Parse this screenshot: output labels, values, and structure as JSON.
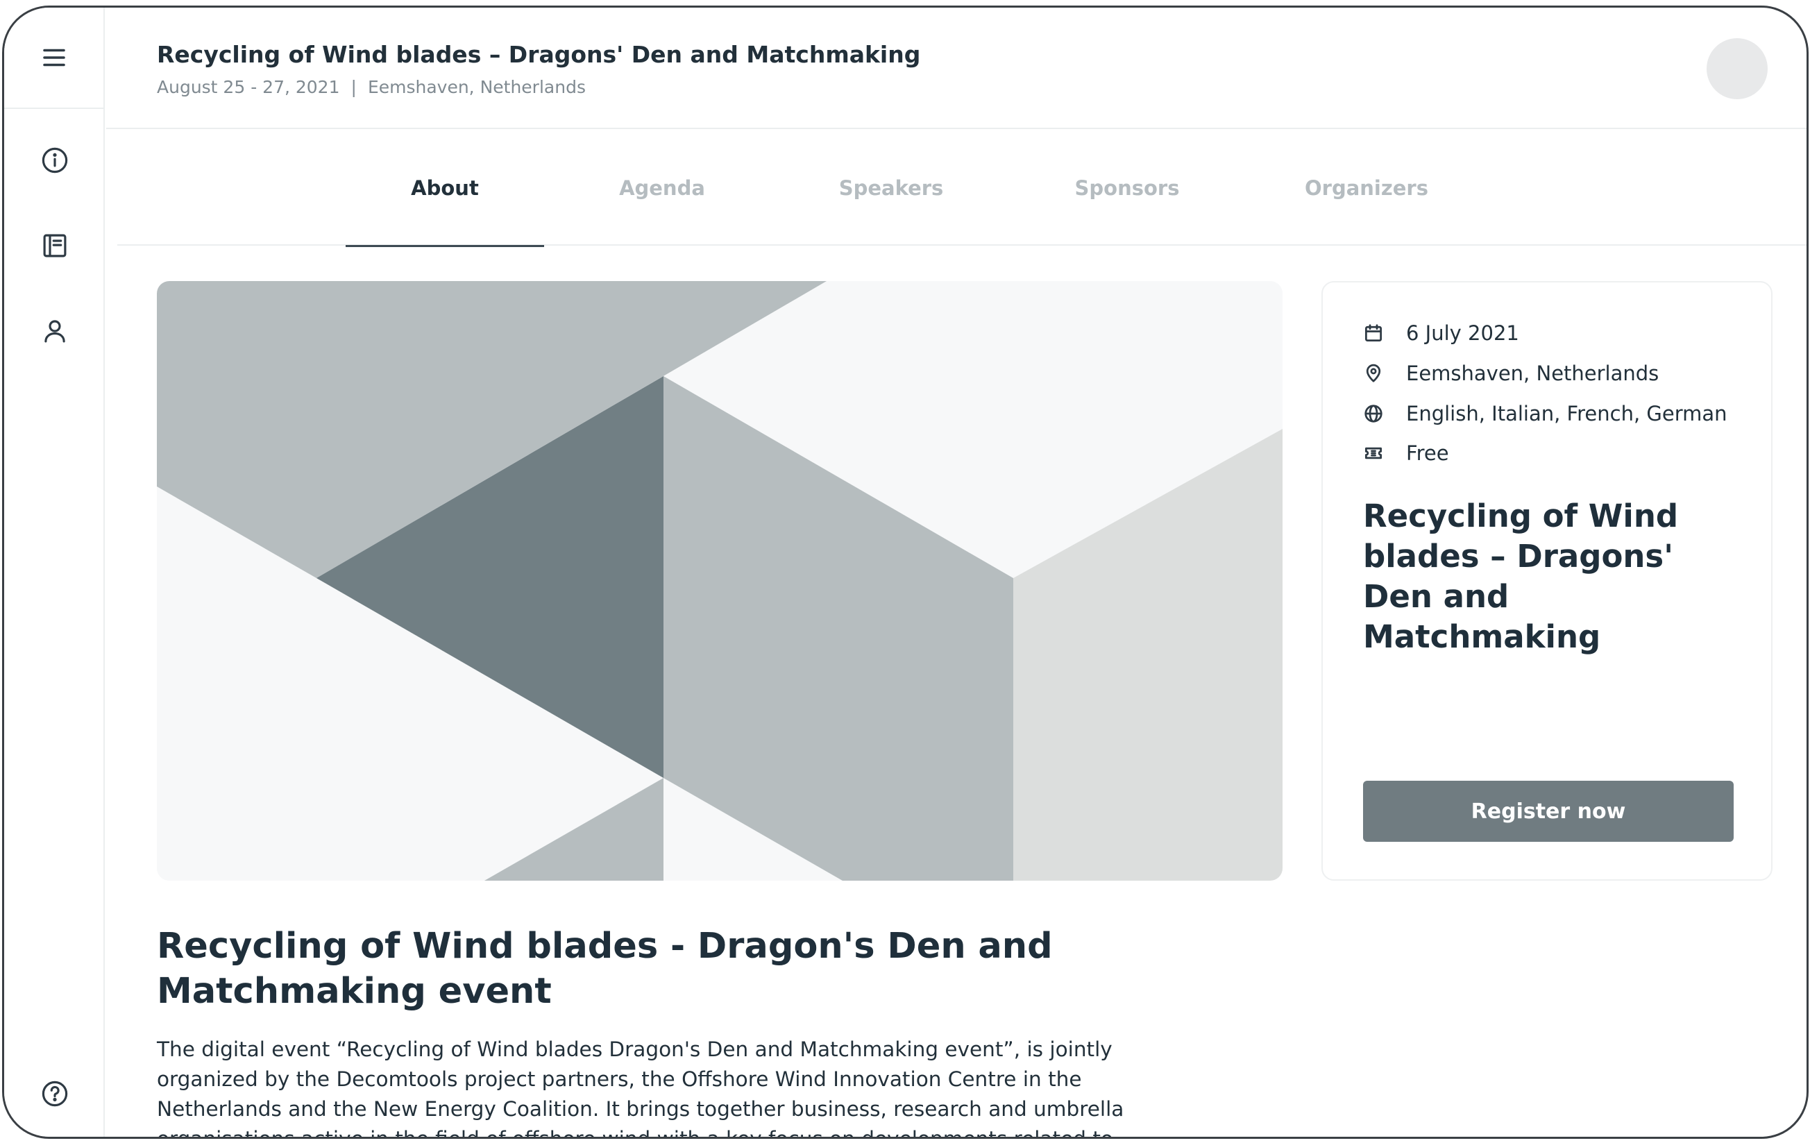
{
  "header": {
    "title": "Recycling of Wind blades – Dragons' Den and Matchmaking",
    "dates": "August 25 - 27, 2021",
    "separator": "|",
    "location": "Eemshaven, Netherlands"
  },
  "sidebar": {
    "items": [
      {
        "icon": "menu-icon"
      },
      {
        "icon": "info-icon"
      },
      {
        "icon": "notebook-icon"
      },
      {
        "icon": "user-icon"
      },
      {
        "icon": "help-icon"
      }
    ]
  },
  "tabs": [
    {
      "label": "About",
      "active": true
    },
    {
      "label": "Agenda",
      "active": false
    },
    {
      "label": "Speakers",
      "active": false
    },
    {
      "label": "Sponsors",
      "active": false
    },
    {
      "label": "Organizers",
      "active": false
    }
  ],
  "card": {
    "date": "6 July 2021",
    "location": "Eemshaven, Netherlands",
    "languages": "English, Italian, French, German",
    "price": "Free",
    "title": "Recycling of Wind blades – Dragons' Den and Matchmaking",
    "register_label": "Register now"
  },
  "main": {
    "title": "Recycling of Wind blades - Dragon's Den and Matchmaking event",
    "description": "The digital event “Recycling of Wind blades Dragon's Den and Matchmaking event”, is jointly organized by the Decomtools project partners, the Offshore Wind Innovation Centre in the Netherlands and the New Energy Coalition. It brings together business, research and umbrella organisations active in the field of offshore wind with a key focus on developments related to the decommissioning of offshore"
  },
  "colors": {
    "accent": "#707c81",
    "text_dark": "#1f2f3b",
    "tab_inactive": "#b5bcc0"
  }
}
